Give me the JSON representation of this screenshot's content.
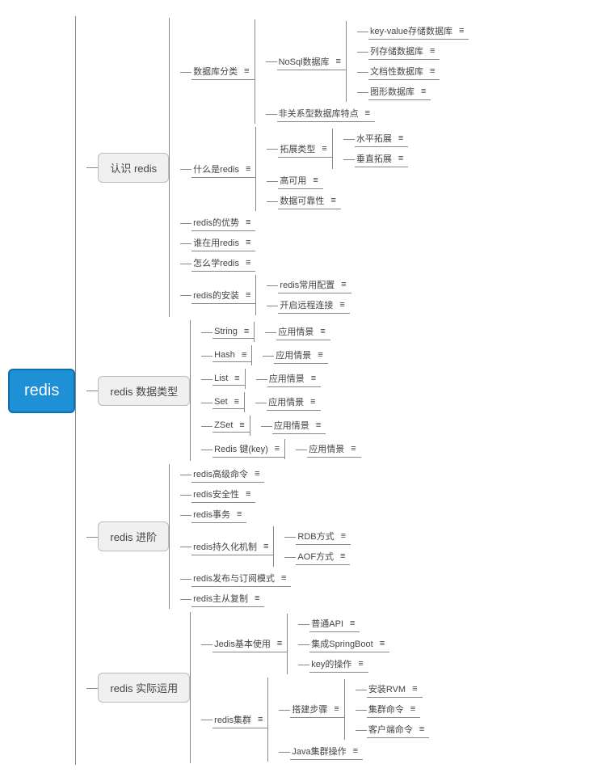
{
  "root": "redis",
  "notes_icon": "≡",
  "level1": {
    "a": "认识 redis",
    "b": "redis 数据类型",
    "c": "redis 进阶",
    "d": "redis 实际运用"
  },
  "a": {
    "db_type": "数据库分类",
    "nosql": "NoSql数据库",
    "nosql_children": {
      "kv": "key-value存储数据库",
      "col": "列存储数据库",
      "doc": "文档性数据库",
      "graph": "图形数据库"
    },
    "nonrel": "非关系型数据库特点",
    "what": "什么是redis",
    "scale_type": "拓展类型",
    "hscale": "水平拓展",
    "vscale": "垂直拓展",
    "ha": "高可用",
    "reliability": "数据可靠性",
    "advantage": "redis的优势",
    "who": "谁在用redis",
    "how_learn": "怎么学redis",
    "install": "redis的安装",
    "config": "redis常用配置",
    "remote": "开启远程连接"
  },
  "b": {
    "string": "String",
    "hash": "Hash",
    "list": "List",
    "set": "Set",
    "zset": "ZSet",
    "key": "Redis 键(key)",
    "usage": "应用情景"
  },
  "c": {
    "adv_cmd": "redis高级命令",
    "security": "redis安全性",
    "tx": "redis事务",
    "persist": "redis持久化机制",
    "rdb": "RDB方式",
    "aof": "AOF方式",
    "pubsub": "redis发布与订阅模式",
    "ms": "redis主从复制"
  },
  "d": {
    "jedis": "Jedis基本使用",
    "api": "普通API",
    "springboot": "集成SpringBoot",
    "keyop": "key的操作",
    "cluster": "redis集群",
    "build": "搭建步骤",
    "rvm": "安装RVM",
    "cluster_cmd": "集群命令",
    "client_cmd": "客户端命令",
    "java_cluster": "Java集群操作"
  }
}
